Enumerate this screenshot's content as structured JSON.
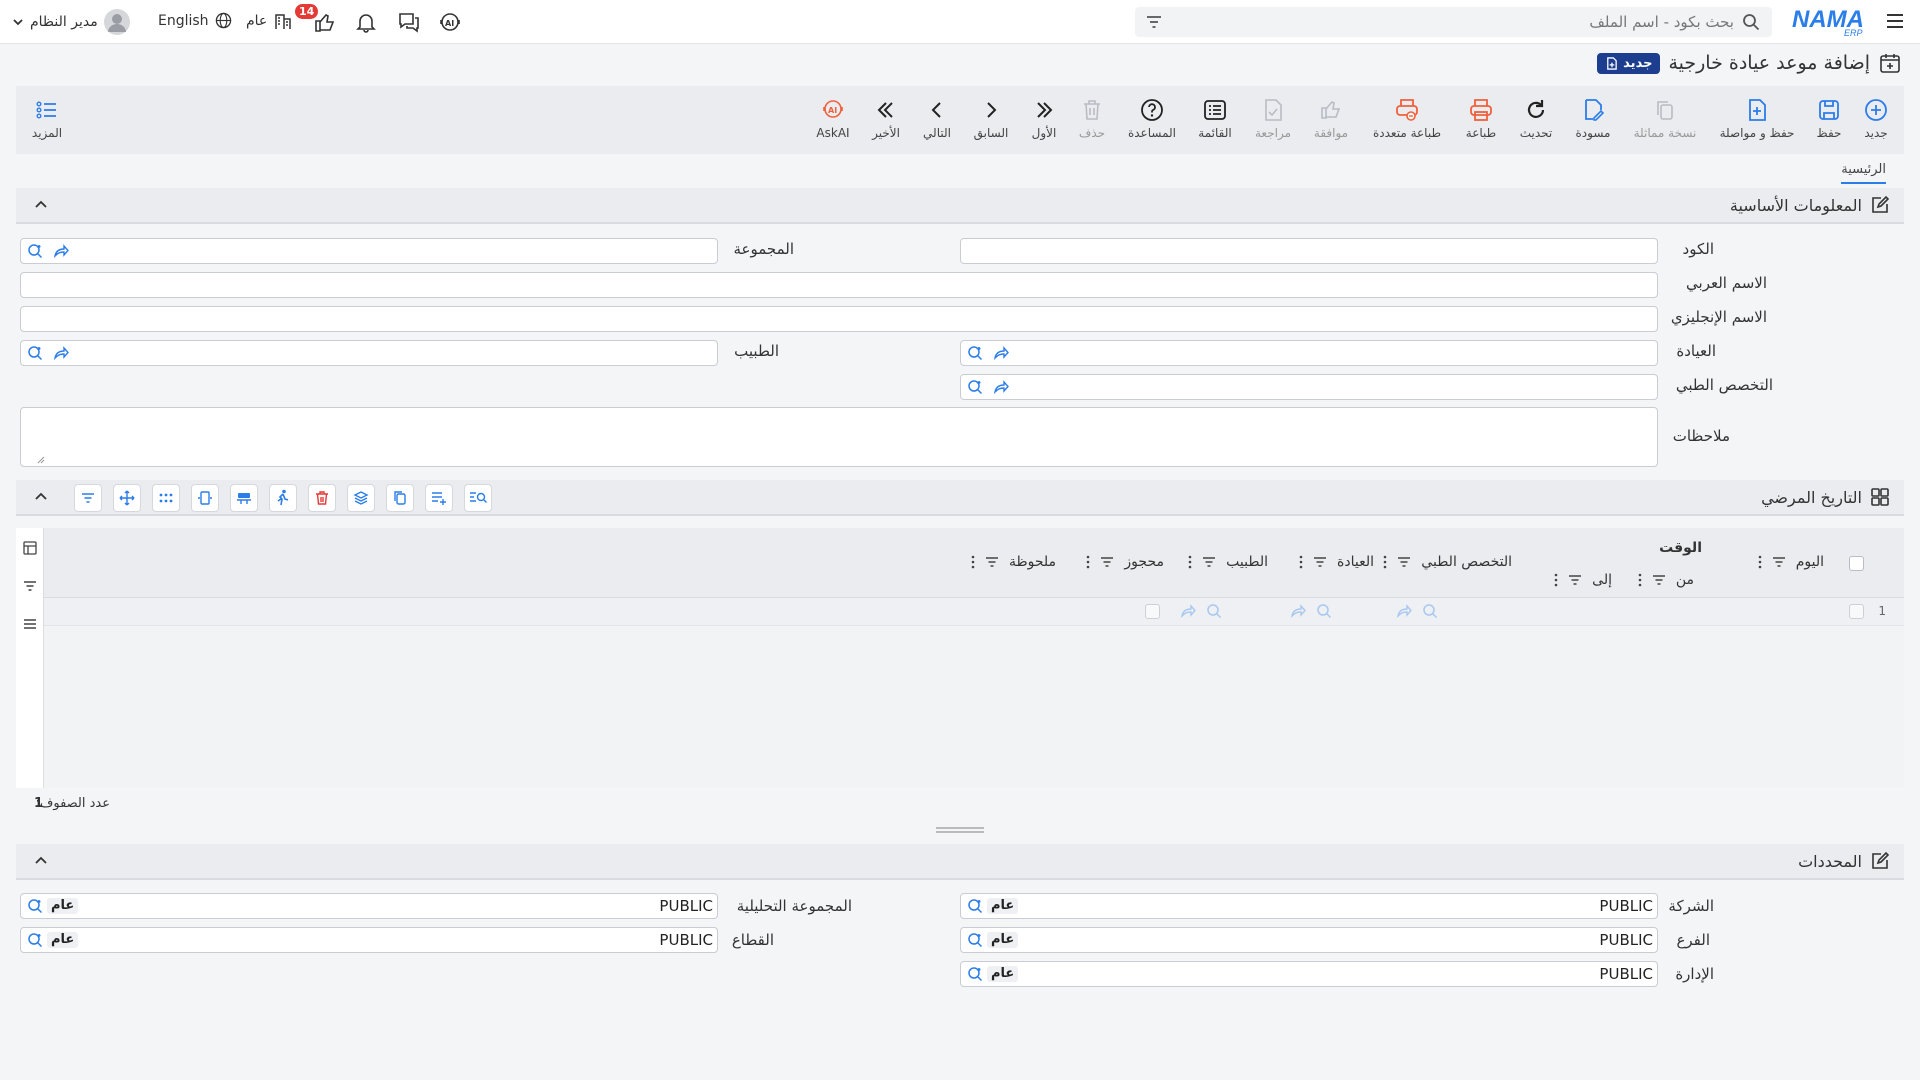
{
  "topbar": {
    "search_placeholder": "بحث بكود - اسم الملف",
    "user_name": "مدير النظام",
    "language": "English",
    "scope": "عام",
    "notification_count": "14"
  },
  "page": {
    "title": "إضافة موعد عيادة خارجية",
    "status_badge": "جديد"
  },
  "toolbar": {
    "buttons": [
      {
        "label": "جديد",
        "icon": "plus-circle-icon"
      },
      {
        "label": "حفظ",
        "icon": "save-icon"
      },
      {
        "label": "حفظ و مواصلة",
        "icon": "save-continue-icon"
      },
      {
        "label": "نسخة مماثلة",
        "icon": "copy-icon"
      },
      {
        "label": "مسودة",
        "icon": "draft-icon"
      },
      {
        "label": "تحديث",
        "icon": "refresh-icon"
      },
      {
        "label": "طباعة",
        "icon": "print-icon"
      },
      {
        "label": "طباعة متعددة",
        "icon": "multi-print-icon"
      },
      {
        "label": "موافقة",
        "icon": "thumbs-up-icon"
      },
      {
        "label": "مراجعة",
        "icon": "review-icon"
      },
      {
        "label": "القائمة",
        "icon": "list-icon"
      },
      {
        "label": "المساعدة",
        "icon": "help-icon"
      },
      {
        "label": "حذف",
        "icon": "trash-icon"
      },
      {
        "label": "الأول",
        "icon": "first-icon"
      },
      {
        "label": "السابق",
        "icon": "previous-icon"
      },
      {
        "label": "التالي",
        "icon": "next-icon"
      },
      {
        "label": "الأخير",
        "icon": "last-icon"
      },
      {
        "label": "AskAI",
        "icon": "ai-icon"
      }
    ],
    "more_label": "المزيد"
  },
  "tabs": {
    "main": "الرئيسية"
  },
  "basic_info": {
    "title": "المعلومات الأساسية",
    "code_label": "الكود",
    "group_label": "المجموعة",
    "arabic_name_label": "الاسم العربي",
    "english_name_label": "الاسم الإنجليزي",
    "clinic_label": "العيادة",
    "doctor_label": "الطبيب",
    "specialty_label": "التخصص الطبي",
    "notes_label": "ملاحظات"
  },
  "history": {
    "title": "التاريخ المرضي",
    "columns": {
      "day": "اليوم",
      "time": "الوقت",
      "from": "من",
      "to": "إلى",
      "specialty": "التخصص الطبي",
      "clinic": "العيادة",
      "doctor": "الطبيب",
      "reserved": "محجوز",
      "note": "ملحوظة"
    },
    "row_number": "1",
    "rows_count_label": "عدد الصفوف:",
    "rows_count": "1"
  },
  "determinants": {
    "title": "المحددات",
    "company_label": "الشركة",
    "analytic_group_label": "المجموعة التحليلية",
    "branch_label": "الفرع",
    "sector_label": "القطاع",
    "department_label": "الإدارة",
    "value": "PUBLIC",
    "tag": "عام"
  },
  "colors": {
    "primary": "#2b7de9",
    "print": "#f0603c",
    "brand_navy": "#1d3d8f"
  }
}
